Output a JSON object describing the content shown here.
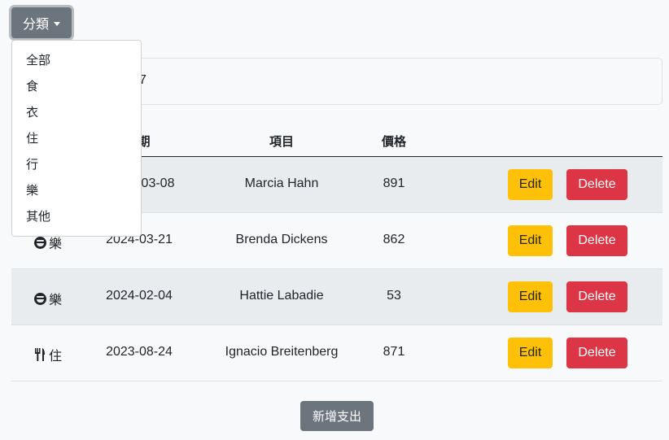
{
  "dropdown": {
    "label": "分類",
    "items": [
      "全部",
      "食",
      "衣",
      "住",
      "行",
      "樂",
      "其他"
    ]
  },
  "summary": {
    "text": "7"
  },
  "table": {
    "headers": {
      "category": "",
      "date": "期",
      "item": "項目",
      "price": "價格"
    },
    "rows": [
      {
        "category": "",
        "category_icon": "",
        "date": "03-08",
        "item": "Marcia Hahn",
        "price": "891",
        "edit": "Edit",
        "delete": "Delete"
      },
      {
        "category": "樂",
        "category_icon": "grin-icon",
        "date": "2024-03-21",
        "item": "Brenda Dickens",
        "price": "862",
        "edit": "Edit",
        "delete": "Delete"
      },
      {
        "category": "樂",
        "category_icon": "grin-icon",
        "date": "2024-02-04",
        "item": "Hattie Labadie",
        "price": "53",
        "edit": "Edit",
        "delete": "Delete"
      },
      {
        "category": "住",
        "category_icon": "utensils-icon",
        "date": "2023-08-24",
        "item": "Ignacio Breitenberg",
        "price": "871",
        "edit": "Edit",
        "delete": "Delete"
      }
    ]
  },
  "add_button": "新增支出",
  "colors": {
    "secondary": "#6c757d",
    "warning": "#ffc107",
    "danger": "#dc3545",
    "stripe": "#e9ecef"
  }
}
